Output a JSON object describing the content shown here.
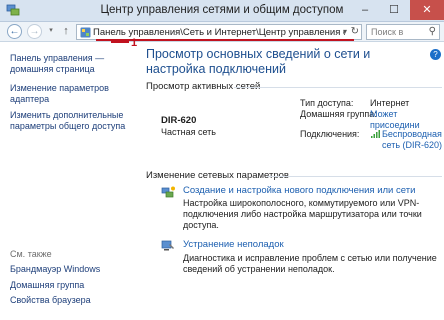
{
  "window": {
    "title": "Центр управления сетями и общим доступом",
    "min": "–",
    "max": "☐",
    "close": "✕"
  },
  "nav": {
    "back": "←",
    "forward": "→",
    "recent": "▾",
    "up": "↑",
    "address": "Панель управления\\Сеть и Интернет\\Центр управления сетями и об",
    "address_dropdown": "▾",
    "refresh": "↻",
    "search_placeholder": "Поиск в",
    "search_icon": "⚲"
  },
  "sidebar": {
    "home": "Панель управления — домашняя страница",
    "adapter": "Изменение параметров адаптера",
    "advanced": "Изменить дополнительные параметры общего доступа",
    "see_also": "См. также",
    "firewall": "Брандмауэр Windows",
    "homegroup": "Домашняя группа",
    "browser": "Свойства браузера"
  },
  "annotation": {
    "marker_number": "1",
    "accent_color": "#c1121f"
  },
  "main": {
    "help": "?",
    "heading": "Просмотр основных сведений о сети и настройка подключений",
    "active_networks": "Просмотр активных сетей",
    "network_name": "DIR-620",
    "network_category": "Частная сеть",
    "access_type_label": "Тип доступа:",
    "access_type_value": "Интернет",
    "homegroup_label": "Домашняя группа:",
    "homegroup_value": "Может присоедини",
    "connections_label": "Подключения:",
    "connections_value": "Беспроводная сеть (DIR-620)",
    "change_settings": "Изменение сетевых параметров",
    "task1_link": "Создание и настройка нового подключения или сети",
    "task1_desc": "Настройка широкополосного, коммутируемого или VPN-подключения либо настройка маршрутизатора или точки доступа.",
    "task2_link": "Устранение неполадок",
    "task2_desc": "Диагностика и исправление проблем с сетью или получение сведений об устранении неполадок."
  },
  "icons": {
    "window_icon": "network-center-icon",
    "address_icon": "control-panel-icon",
    "wifi": "wifi-signal-icon",
    "task1": "new-connection-icon",
    "task2": "troubleshoot-icon"
  }
}
